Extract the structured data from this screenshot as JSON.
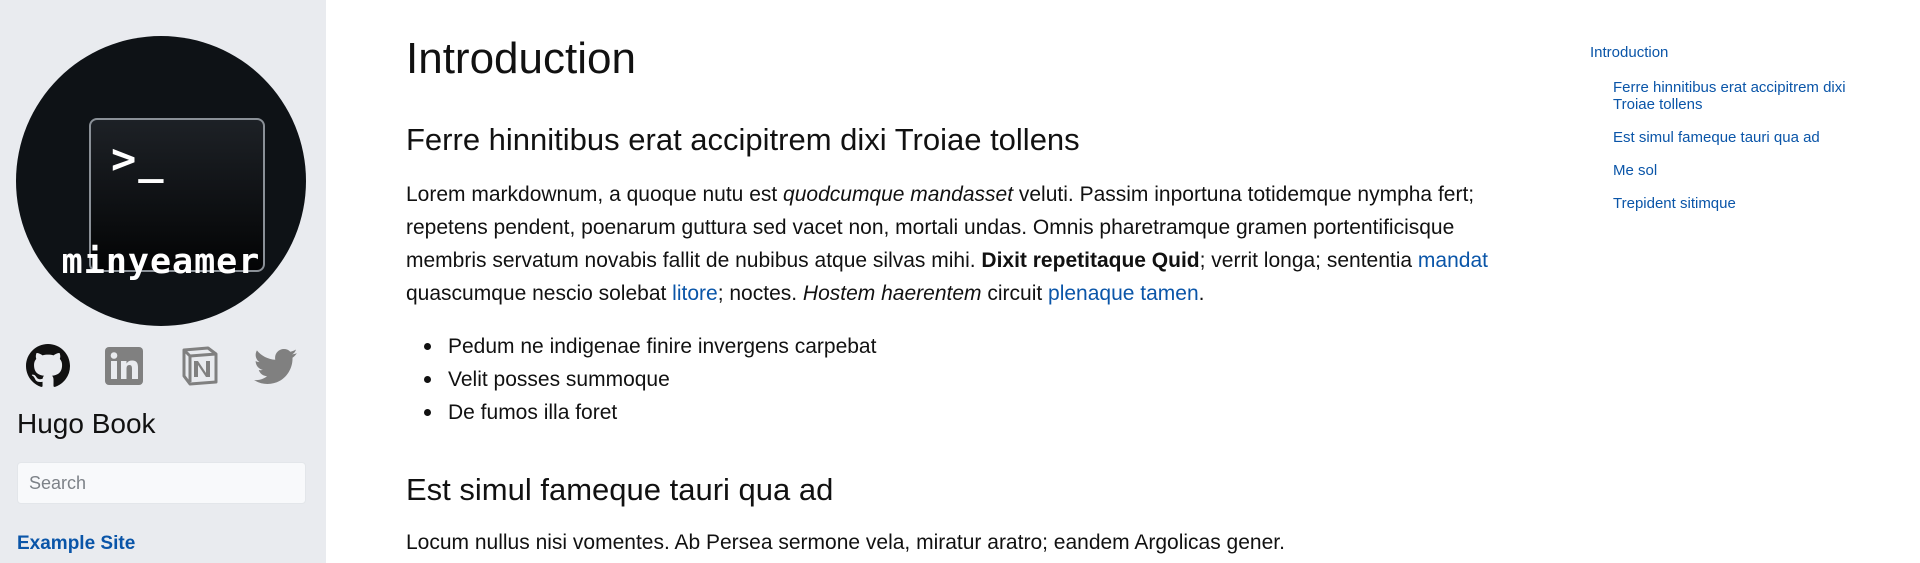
{
  "sidebar": {
    "logo_prompt": ">_",
    "logo_name": "minyeamer",
    "socials": [
      {
        "icon": "github-icon"
      },
      {
        "icon": "linkedin-icon"
      },
      {
        "icon": "notion-icon"
      },
      {
        "icon": "twitter-icon"
      }
    ],
    "site_title": "Hugo Book",
    "search_placeholder": "Search",
    "site_link": "Example Site"
  },
  "main": {
    "title": "Introduction",
    "section1": {
      "heading": "Ferre hinnitibus erat accipitrem dixi Troiae tollens",
      "p_1": "Lorem markdownum, a quoque nutu est ",
      "p_em1": "quodcumque mandasset",
      "p_2": " veluti. Passim inportuna totidemque nympha fert; repetens pendent, poenarum guttura sed vacet non, mortali undas. Omnis pharetramque gramen portentificisque membris servatum novabis fallit de nubibus atque silvas mihi. ",
      "p_strong": "Dixit repetitaque Quid",
      "p_3": "; verrit longa; sententia ",
      "p_link1": "mandat",
      "p_4": " quascumque nescio solebat ",
      "p_link2": "litore",
      "p_5": "; noctes. ",
      "p_em2": "Hostem haerentem",
      "p_6": " circuit ",
      "p_link3": "plenaque tamen",
      "p_7": ".",
      "list": [
        "Pedum ne indigenae finire invergens carpebat",
        "Velit posses summoque",
        "De fumos illa foret"
      ]
    },
    "section2": {
      "heading": "Est simul fameque tauri qua ad",
      "p": "Locum nullus nisi vomentes. Ab Persea sermone vela, miratur aratro; eandem Argolicas gener."
    }
  },
  "toc": {
    "top": "Introduction",
    "items": [
      "Ferre hinnitibus erat accipitrem dixi Troiae tollens",
      "Est simul fameque tauri qua ad",
      "Me sol",
      "Trepident sitimque"
    ]
  },
  "colors": {
    "sidebar_bg": "#e9ebef",
    "link": "#0a55a8",
    "logo_bg": "#0e1216"
  }
}
